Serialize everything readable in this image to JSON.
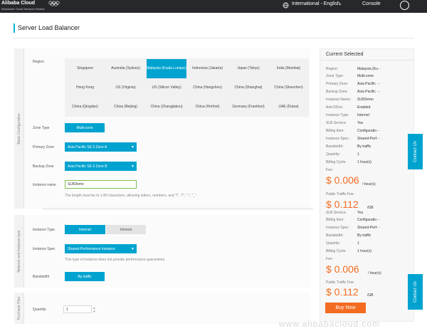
{
  "topbar": {
    "logo": "Alibaba Cloud",
    "logo_sub": "Worldwide Cloud Services Partner",
    "language": "International - English",
    "console": "Console"
  },
  "page": {
    "title": "Server Load Balancer"
  },
  "basic": {
    "side_label": "Basic Configuration",
    "region_label": "Region",
    "regions": [
      "Singapore",
      "Australia (Sydney)",
      "Malaysia (Kuala Lumpur)",
      "Indonesia (Jakarta)",
      "Japan (Tokyo)",
      "India (Mumbai)",
      "Hong Kong",
      "US (Virginia)",
      "US (Silicon Valley)",
      "China (Hangzhou)",
      "China (Shanghai)",
      "China (Shenzhen)",
      "China (Qingdao)",
      "China (Beijing)",
      "China (Zhangjiakou)",
      "China (Hohhot)",
      "Germany (Frankfurt)",
      "UAE (Dubai)"
    ],
    "zone_type_label": "Zone Type",
    "zone_type_value": "Multi-zone",
    "primary_zone_label": "Primary Zone",
    "primary_zone_value": "Asia Pacific SE 3 Zone A",
    "backup_zone_label": "Backup Zone",
    "backup_zone_value": "Asia Pacific SE 3 Zone B",
    "instance_name_label": "Instance name",
    "instance_name_value": "SLBDemo",
    "instance_name_help": "The length must be to 1-80 characters, allowing letters, numbers, and \"/\", \"/\", \"-\", \"_\""
  },
  "network": {
    "side_label": "Network and Instance type",
    "instance_type_label": "Instance Type",
    "instance_type_options": [
      "Internet",
      "Intranet"
    ],
    "instance_spec_label": "Instance Spec",
    "instance_spec_value": "Shared-Performance Instance",
    "instance_spec_help": "This type of instance does not provide performance guarantees.",
    "bandwidth_label": "Bandwidth",
    "bandwidth_value": "By traffic"
  },
  "purchase": {
    "side_label": "Purchase Plan",
    "quantity_label": "Quantity",
    "quantity_value": "1"
  },
  "summary": {
    "title": "Current Selected",
    "rows_top": [
      {
        "k": "Region:",
        "v": "Malaysia (Ku···"
      },
      {
        "k": "Zone Type:",
        "v": "Multi-zone"
      },
      {
        "k": "Primary Zone:",
        "v": "Asia Pacific ···"
      },
      {
        "k": "Backup Zone:",
        "v": "Asia Pacific ···"
      },
      {
        "k": "Instance Name:",
        "v": "SLBDemo"
      },
      {
        "k": "Anti-DDos:",
        "v": "Enabled"
      },
      {
        "k": "Instance Type:",
        "v": "Internet"
      },
      {
        "k": "SLB Service:",
        "v": "Yes"
      },
      {
        "k": "Billing Item:",
        "v": "Configuratio···"
      },
      {
        "k": "Instance Spec:",
        "v": "Shared-Perf···"
      },
      {
        "k": "Bandwidth:",
        "v": "By traffic"
      },
      {
        "k": "Quantity:",
        "v": "1"
      },
      {
        "k": "Billing Cycle:",
        "v": "1 hour(s)"
      }
    ],
    "rows_bottom": [
      {
        "k": "SLB Service:",
        "v": "Yes"
      },
      {
        "k": "Billing Item:",
        "v": "Configuratio···"
      },
      {
        "k": "Instance Spec:",
        "v": "Shared-Perf···"
      },
      {
        "k": "Bandwidth:",
        "v": "By traffic"
      },
      {
        "k": "Quantity:",
        "v": "1"
      },
      {
        "k": "Billing Cycle:",
        "v": "1 hour(s)"
      }
    ],
    "fee_label": "Fee:",
    "fee_price": "$ 0.006",
    "fee_unit": "/ hour(s)",
    "traffic_label": "Public Traffic Fee:",
    "traffic_price": "$ 0.112",
    "traffic_unit": "/GB",
    "fee_label2": "Fee:",
    "fee_price2": "$ 0.006",
    "fee_unit2": "/ hour(s)",
    "traffic_label2": "Public Traffic Fee:",
    "traffic_price2": "$ 0.112",
    "traffic_unit2": "/GB",
    "buy_label": "Buy Now",
    "contact_label": "Contact Us"
  },
  "watermark": "www.alibabacloud.com",
  "colors": {
    "accent": "#00a3d0",
    "price": "#f36c21",
    "topbar": "#26282c"
  }
}
